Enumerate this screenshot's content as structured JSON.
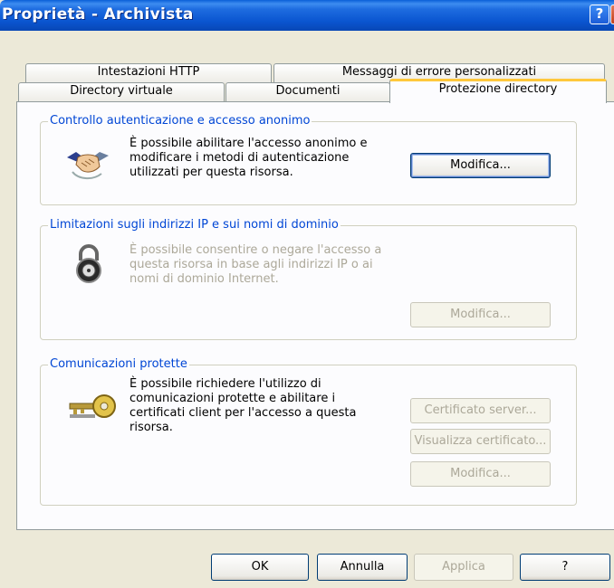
{
  "window": {
    "title": "Proprietà - Archivista",
    "help_glyph": "?",
    "close_glyph": "✕"
  },
  "tabs": {
    "row1": [
      "Intestazioni HTTP",
      "Messaggi di errore personalizzati"
    ],
    "row2": [
      "Directory virtuale",
      "Documenti",
      "Protezione directory"
    ],
    "selected": "Protezione directory"
  },
  "groups": {
    "auth": {
      "label": "Controllo autenticazione e accesso anonimo",
      "description": "È possibile abilitare l'accesso anonimo e modificare i metodi di autenticazione utilizzati per questa risorsa.",
      "button": "Modifica...",
      "icon": "handshake-icon"
    },
    "ip": {
      "label": "Limitazioni sugli indirizzi IP e sui nomi di dominio",
      "description": "È possibile consentire o negare l'accesso a questa risorsa in base agli indirizzi IP o ai nomi di dominio Internet.",
      "button": "Modifica...",
      "icon": "padlock-icon"
    },
    "secure": {
      "label": "Comunicazioni protette",
      "description": "È possibile richiedere l'utilizzo di comunicazioni protette e abilitare i certificati client per l'accesso a questa risorsa.",
      "buttons": [
        "Certificato server...",
        "Visualizza certificato...",
        "Modifica..."
      ],
      "icon": "keys-icon"
    }
  },
  "footer": {
    "buttons": [
      "OK",
      "Annulla",
      "Applica",
      "?"
    ]
  },
  "colors": {
    "titlebar": "#0A55D0",
    "group_label": "#0046D5",
    "dialog": "#ECE9D8",
    "tab_highlight": "#FFC83C"
  }
}
